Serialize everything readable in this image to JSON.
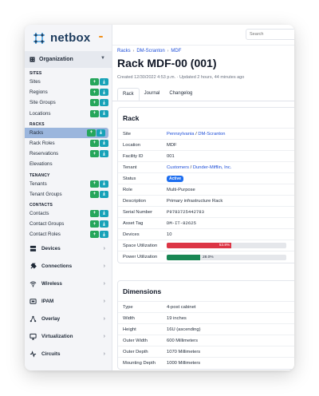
{
  "brand": {
    "name": "netbox",
    "accent": "#f0901a"
  },
  "sidebar": {
    "organization_label": "Organization",
    "sections": [
      {
        "title": "SITES",
        "items": [
          {
            "label": "Sites",
            "buttons": true
          },
          {
            "label": "Regions",
            "buttons": true
          },
          {
            "label": "Site Groups",
            "buttons": true
          },
          {
            "label": "Locations",
            "buttons": true
          }
        ]
      },
      {
        "title": "RACKS",
        "items": [
          {
            "label": "Racks",
            "buttons": true,
            "active": true
          },
          {
            "label": "Rack Roles",
            "buttons": true
          },
          {
            "label": "Reservations",
            "buttons": true
          },
          {
            "label": "Elevations",
            "buttons": false
          }
        ]
      },
      {
        "title": "TENANCY",
        "items": [
          {
            "label": "Tenants",
            "buttons": true
          },
          {
            "label": "Tenant Groups",
            "buttons": true
          }
        ]
      },
      {
        "title": "CONTACTS",
        "items": [
          {
            "label": "Contacts",
            "buttons": true
          },
          {
            "label": "Contact Groups",
            "buttons": true
          },
          {
            "label": "Contact Roles",
            "buttons": true
          }
        ]
      }
    ],
    "groups": [
      {
        "label": "Devices",
        "icon": "server-icon"
      },
      {
        "label": "Connections",
        "icon": "plug-icon"
      },
      {
        "label": "Wireless",
        "icon": "wifi-icon"
      },
      {
        "label": "IPAM",
        "icon": "ipam-icon"
      },
      {
        "label": "Overlay",
        "icon": "overlay-icon"
      },
      {
        "label": "Virtualization",
        "icon": "monitor-icon"
      },
      {
        "label": "Circuits",
        "icon": "circuit-icon"
      }
    ],
    "add_glyph": "+",
    "import_glyph": "⤓"
  },
  "header": {
    "search_placeholder": "Search"
  },
  "breadcrumb": [
    "Racks",
    "DM-Scranton",
    "MDF"
  ],
  "page": {
    "title": "Rack MDF-00 (001)",
    "meta": "Created 12/30/2022 4:53 p.m. · Updated 2 hours, 44 minutes ago"
  },
  "tabs": [
    "Rack",
    "Journal",
    "Changelog"
  ],
  "rack_card": {
    "title": "Rack",
    "site_region": "Pennsylvania",
    "site_sep": " / ",
    "site_name": "DM-Scranton",
    "rows": {
      "site": "Site",
      "location": "Location",
      "location_val": "MDF",
      "facility": "Facility ID",
      "facility_val": "001",
      "tenant": "Tenant",
      "tenant_group": "Customers",
      "tenant_name": "Dunder-Mifflin, Inc.",
      "status": "Status",
      "status_val": "Active",
      "role": "Role",
      "role_val": "Multi-Purpose",
      "description": "Description",
      "description_val": "Primary infrastructure Rack",
      "serial": "Serial Number",
      "serial_val": "P9783725442783",
      "asset": "Asset Tag",
      "asset_val": "DM-IT-82625",
      "devices": "Devices",
      "devices_val": "10",
      "space": "Space Utilization",
      "space_pct": 53.8,
      "space_label": "53.8%",
      "space_color": "#dc3545",
      "power": "Power Utilization",
      "power_pct": 28.0,
      "power_label": "28.0%",
      "power_color": "#198754"
    }
  },
  "dimensions_card": {
    "title": "Dimensions",
    "rows": [
      {
        "k": "Type",
        "v": "4-post cabinet"
      },
      {
        "k": "Width",
        "v": "19 inches"
      },
      {
        "k": "Height",
        "v": "16U (ascending)"
      },
      {
        "k": "Outer Width",
        "v": "600 Millimeters"
      },
      {
        "k": "Outer Depth",
        "v": "1070 Millimeters"
      },
      {
        "k": "Mounting Depth",
        "v": "1000 Millimeters"
      }
    ]
  }
}
